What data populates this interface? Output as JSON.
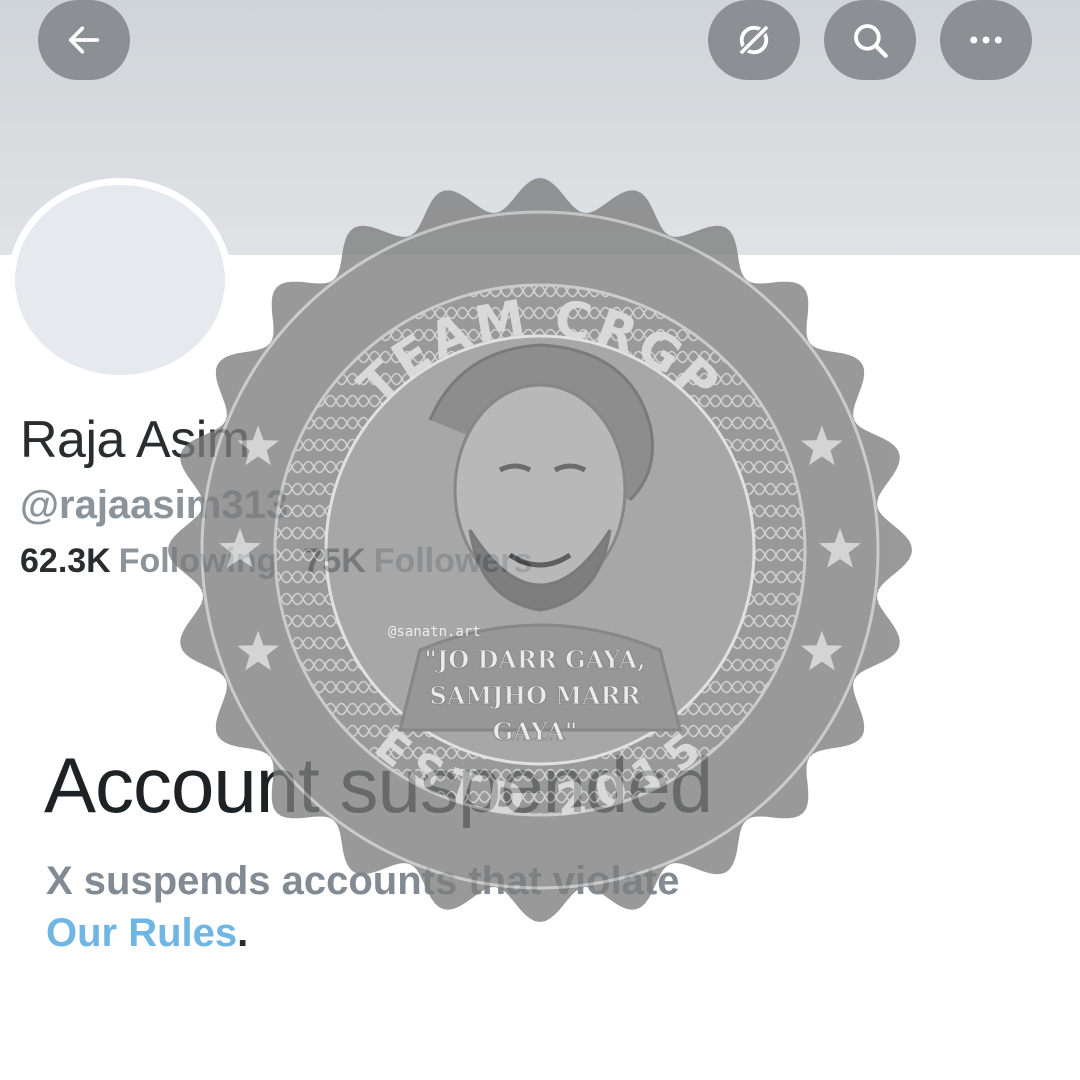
{
  "header": {
    "icons": [
      "arrow-left-icon",
      "grok-icon",
      "search-icon",
      "more-horizontal-icon"
    ]
  },
  "profile": {
    "display_name": "Raja Asim",
    "handle": "@rajaasim313",
    "following_count": "62.3K",
    "following_label": "Following",
    "followers_count": "75K",
    "followers_label": "Followers"
  },
  "suspension": {
    "title": "Account suspended",
    "description": "X suspends accounts that violate",
    "rules_link": "Our Rules",
    "period": "."
  },
  "watermark": {
    "top_text": "TEAM CRGP",
    "bottom_text": "ESTD 2015",
    "artist_credit": "@sanatn.art",
    "quote_line1": "\"JO DARR GAYA,",
    "quote_line2": "SAMJHO MARR",
    "quote_line3": "GAYA\""
  },
  "colors": {
    "button_bg": "#8c9095",
    "banner_bg": "#d9dde0",
    "link": "#6fb6e4",
    "muted_text": "#8b939b",
    "seal_gray": "#8a8a8a"
  }
}
